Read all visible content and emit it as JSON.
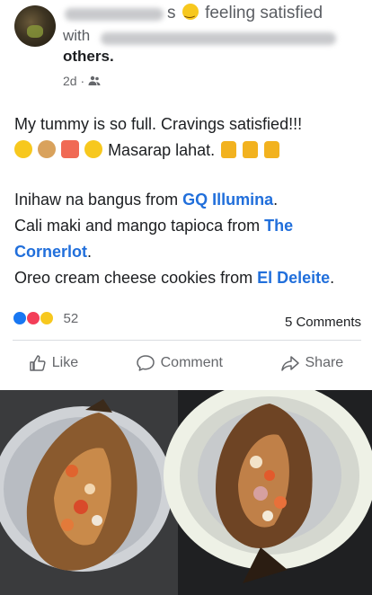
{
  "post": {
    "author_suffix": "s",
    "feeling": "feeling satisfied",
    "with_prefix": "with",
    "others_label": "others.",
    "time": "2d",
    "audience_icon": "friends-icon",
    "text_line1": "My tummy is so full. Cravings satisfied!!!",
    "text_line2": "Masarap lahat.",
    "p1_text": "Inihaw na bangus from",
    "p1_link": "GQ Illumina",
    "p1_end": ".",
    "p2_text": "Cali maki and mango tapioca from",
    "p2_link": "The Cornerlot",
    "p2_end": ".",
    "p3_text": "Oreo cream cheese cookies from",
    "p3_link": "El Deleite",
    "p3_end": "."
  },
  "stats": {
    "reactions_count": "52",
    "comments_label": "5 Comments"
  },
  "actions": {
    "like_label": "Like",
    "comment_label": "Comment",
    "share_label": "Share"
  },
  "colors": {
    "link": "#216fdb",
    "meta": "#65676b",
    "like": "#1877f2"
  }
}
